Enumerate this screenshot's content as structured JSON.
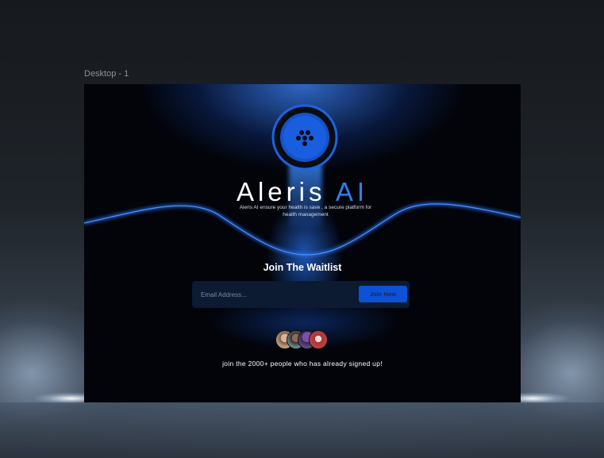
{
  "canvas": {
    "frame_label": "Desktop - 1"
  },
  "brand": {
    "name_main": "Aleris",
    "name_accent": "AI",
    "tagline": "Aleris AI ensure your health is save , a secure platform for health management",
    "accent_color": "#2f7ff0"
  },
  "waitlist": {
    "heading": "Join The Waitlist",
    "email_placeholder": "Email Address...",
    "email_value": "",
    "button_label": "Join Now",
    "button_color": "#0d52d6"
  },
  "social_proof": {
    "text": "join the 2000+ people who has already signed up!",
    "avatars": [
      "avatar-1",
      "avatar-2",
      "avatar-3",
      "avatar-4"
    ]
  },
  "icons": {
    "logo": "brand-logo-icon"
  }
}
